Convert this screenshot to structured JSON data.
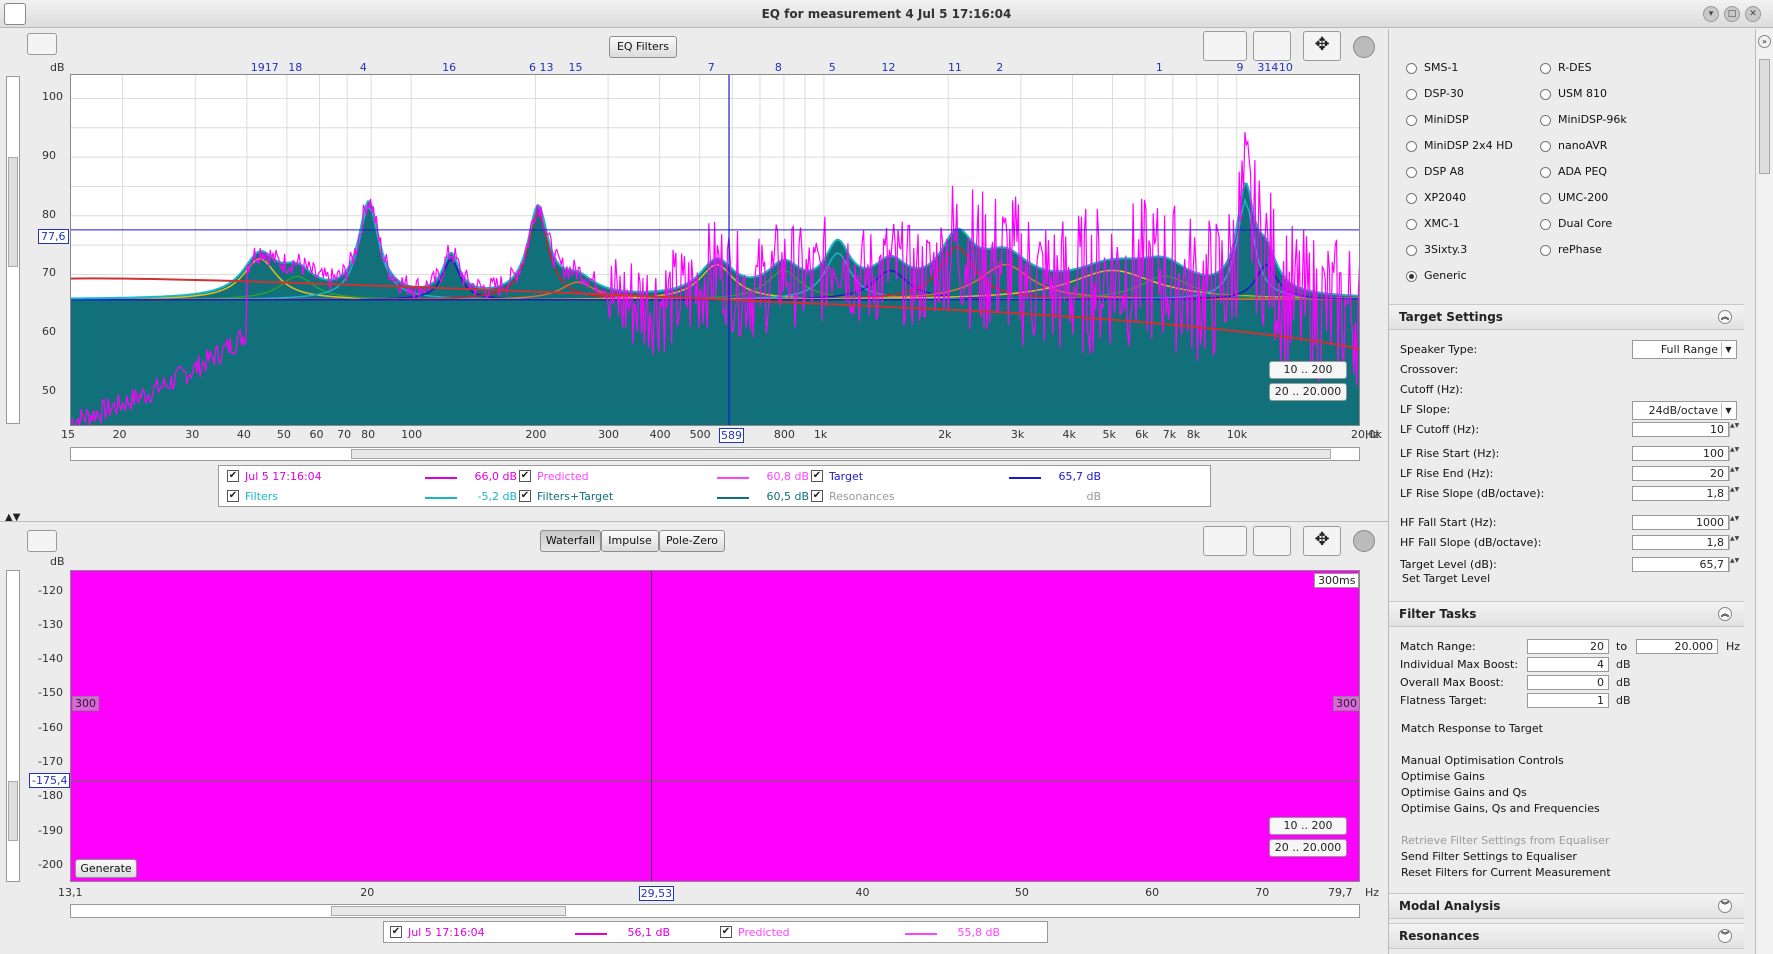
{
  "window": {
    "title": "EQ for measurement 4 Jul 5 17:16:04"
  },
  "colors": {
    "measurement": "#dd00dd",
    "predicted": "#ff44ff",
    "filters": "#1ab6c4",
    "filters_target": "#11707a",
    "target": "#1a1acc",
    "waterfall": "#ff00ff"
  },
  "top_graph": {
    "eq_filters_button": "EQ Filters",
    "y_unit": "dB",
    "y_ticks": [
      "100",
      "90",
      "80",
      "70",
      "60",
      "50"
    ],
    "x_ticks": [
      "15",
      "20",
      "30",
      "40",
      "50",
      "60",
      "70",
      "80",
      "100",
      "200",
      "300",
      "400",
      "500",
      "589",
      "800",
      "1k",
      "2k",
      "3k",
      "4k",
      "5k",
      "6k",
      "7k",
      "8k",
      "10k",
      "20,0k"
    ],
    "x_unit": "Hz",
    "cursor_y_readout": "77,6",
    "cursor_x_readout": "589",
    "filter_markers": [
      "1917",
      "18",
      "4",
      "16",
      "6 13",
      "15",
      "7",
      "8",
      "5",
      "12",
      "11",
      "2",
      "1",
      "9",
      "314",
      "10"
    ],
    "range_button_1": "10 .. 200",
    "range_button_2": "20 .. 20.000",
    "legend": [
      {
        "name": "Jul 5 17:16:04",
        "value": "66,0 dB"
      },
      {
        "name": "Predicted",
        "value": "60,8 dB"
      },
      {
        "name": "Target",
        "value": "65,7 dB"
      },
      {
        "name": "Filters",
        "value": "-5,2 dB"
      },
      {
        "name": "Filters+Target",
        "value": "60,5 dB"
      },
      {
        "name": "Resonances",
        "value": "dB"
      }
    ]
  },
  "bottom_graph": {
    "tabs": [
      "Waterfall",
      "Impulse",
      "Pole-Zero"
    ],
    "active_tab": "Waterfall",
    "y_unit": "dB",
    "y_ticks": [
      "-120",
      "-130",
      "-140",
      "-150",
      "-160",
      "-170",
      "-180",
      "-190",
      "-200"
    ],
    "x_ticks": [
      "13,1",
      "20",
      "29,53",
      "40",
      "50",
      "60",
      "70",
      "79,7"
    ],
    "x_unit": "Hz",
    "cursor_y_readout": "-175,4",
    "time_label": "300ms",
    "side_label_left": "300",
    "side_label_right": "300",
    "generate_button": "Generate",
    "range_button_1": "10 .. 200",
    "range_button_2": "20 .. 20.000",
    "legend": [
      {
        "name": "Jul 5 17:16:04",
        "value": "56,1 dB"
      },
      {
        "name": "Predicted",
        "value": "55,8 dB"
      }
    ]
  },
  "equaliser": {
    "left": [
      "SMS-1",
      "DSP-30",
      "MiniDSP",
      "MiniDSP 2x4 HD",
      "DSP A8",
      "XP2040",
      "XMC-1",
      "3Sixty.3",
      "Generic"
    ],
    "right": [
      "R-DES",
      "USM 810",
      "MiniDSP-96k",
      "nanoAVR",
      "ADA PEQ",
      "UMC-200",
      "Dual Core",
      "rePhase"
    ],
    "selected": "Generic"
  },
  "target_settings": {
    "header": "Target Settings",
    "speaker_type_label": "Speaker Type:",
    "speaker_type": "Full Range",
    "crossover_label": "Crossover:",
    "cutoff_label": "Cutoff (Hz):",
    "lf_slope_label": "LF Slope:",
    "lf_slope": "24dB/octave",
    "lf_cutoff_label": "LF Cutoff (Hz):",
    "lf_cutoff": "10",
    "lf_rise_start_label": "LF Rise Start (Hz):",
    "lf_rise_start": "100",
    "lf_rise_end_label": "LF Rise End (Hz):",
    "lf_rise_end": "20",
    "lf_rise_slope_label": "LF Rise Slope (dB/octave):",
    "lf_rise_slope": "1,8",
    "hf_fall_start_label": "HF Fall Start (Hz):",
    "hf_fall_start": "1000",
    "hf_fall_slope_label": "HF Fall Slope (dB/octave):",
    "hf_fall_slope": "1,8",
    "target_level_label": "Target Level (dB):",
    "target_level": "65,7",
    "set_target_level": "Set Target Level"
  },
  "filter_tasks": {
    "header": "Filter Tasks",
    "match_range_label": "Match Range:",
    "match_from": "20",
    "to_label": "to",
    "match_to": "20.000",
    "hz": "Hz",
    "individual_max_boost_label": "Individual Max Boost:",
    "individual_max_boost": "4",
    "overall_max_boost_label": "Overall Max Boost:",
    "overall_max_boost": "0",
    "flatness_target_label": "Flatness Target:",
    "flatness_target": "1",
    "db": "dB",
    "match_response": "Match Response to Target",
    "manual_opt": "Manual Optimisation Controls",
    "opt_gains": "Optimise Gains",
    "opt_gains_qs": "Optimise Gains and Qs",
    "opt_gains_qs_freq": "Optimise Gains, Qs and Frequencies",
    "retrieve": "Retrieve Filter Settings from Equaliser",
    "send": "Send Filter Settings to Equaliser",
    "reset": "Reset Filters for Current Measurement"
  },
  "modal_analysis": {
    "header": "Modal Analysis"
  },
  "resonances": {
    "header": "Resonances"
  }
}
